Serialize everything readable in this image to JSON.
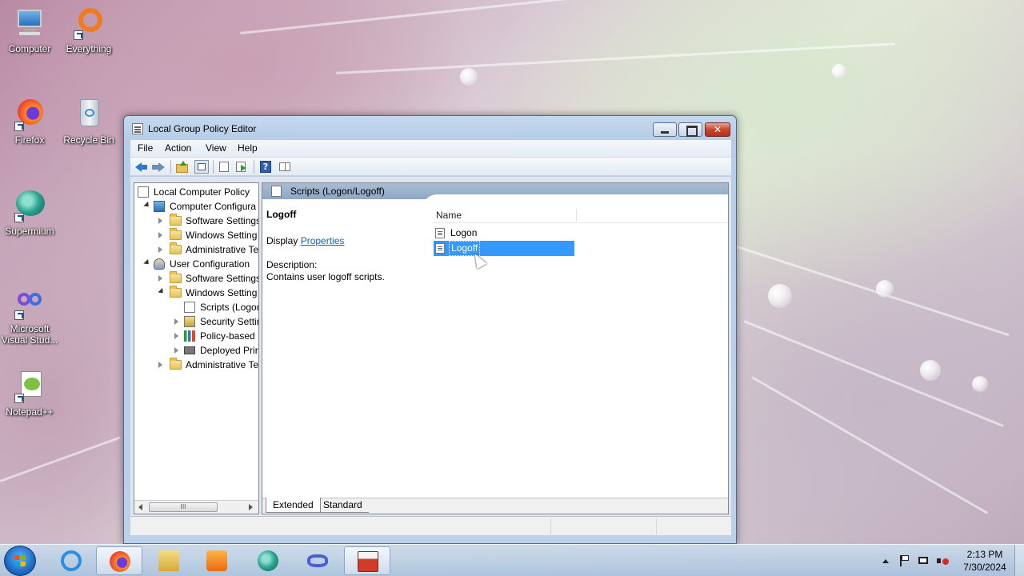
{
  "desktop": {
    "icons": [
      {
        "label": "Computer",
        "icon": "computer-icon"
      },
      {
        "label": "Everything",
        "icon": "everything-search-icon"
      },
      {
        "label": "Firefox",
        "icon": "firefox-icon"
      },
      {
        "label": "Recycle Bin",
        "icon": "recycle-bin-icon"
      },
      {
        "label": "Supermium",
        "icon": "supermium-icon"
      },
      {
        "label": "Microsoft Visual Stud...",
        "icon": "visual-studio-icon"
      },
      {
        "label": "Notepad++",
        "icon": "notepadplusplus-icon"
      }
    ]
  },
  "window": {
    "title": "Local Group Policy Editor",
    "menu": [
      "File",
      "Action",
      "View",
      "Help"
    ],
    "toolbar_icons": [
      "back-arrow-icon",
      "forward-arrow-icon",
      "up-folder-icon",
      "show-tree-icon",
      "properties-icon",
      "export-list-icon",
      "help-icon",
      "show-action-pane-icon"
    ],
    "tree": [
      {
        "label": "Local Computer Policy",
        "icon": "policy-icon",
        "expander": "none"
      },
      {
        "label": "Computer Configura",
        "icon": "computer-config-icon",
        "expander": "open"
      },
      {
        "label": "Software Settings",
        "icon": "folder-icon",
        "expander": "closed"
      },
      {
        "label": "Windows Setting",
        "icon": "folder-icon",
        "expander": "closed"
      },
      {
        "label": "Administrative Te",
        "icon": "folder-icon",
        "expander": "closed"
      },
      {
        "label": "User Configuration",
        "icon": "user-config-icon",
        "expander": "open"
      },
      {
        "label": "Software Settings",
        "icon": "folder-icon",
        "expander": "closed"
      },
      {
        "label": "Windows Setting",
        "icon": "folder-icon",
        "expander": "open"
      },
      {
        "label": "Scripts (Logon",
        "icon": "script-icon",
        "expander": "none"
      },
      {
        "label": "Security Settir",
        "icon": "security-icon",
        "expander": "closed"
      },
      {
        "label": "Policy-based",
        "icon": "chart-icon",
        "expander": "closed"
      },
      {
        "label": "Deployed Prir",
        "icon": "printer-icon",
        "expander": "closed"
      },
      {
        "label": "Administrative Te",
        "icon": "folder-icon",
        "expander": "closed"
      }
    ],
    "tree_scroll_grip": "III",
    "right_header": "Scripts (Logon/Logoff)",
    "details": {
      "title": "Logoff",
      "display_prefix": "Display",
      "display_link": "Properties",
      "description_label": "Description:",
      "description_text": "Contains user logoff scripts."
    },
    "list": {
      "column": "Name",
      "items": [
        {
          "label": "Logon",
          "selected": false
        },
        {
          "label": "Logoff",
          "selected": true
        }
      ]
    },
    "tabs": [
      "Extended",
      "Standard"
    ],
    "active_tab": "Extended"
  },
  "taskbar": {
    "pinned": [
      "internet-explorer-icon",
      "firefox-icon",
      "file-explorer-icon",
      "media-player-icon",
      "supermium-icon",
      "visual-studio-icon",
      "group-policy-editor-icon"
    ],
    "active": "group-policy-editor-icon",
    "clock_time": "2:13 PM",
    "clock_date": "7/30/2024",
    "tray_icons": [
      "show-hidden-icons-icon",
      "action-center-flag-icon",
      "network-icon",
      "volume-muted-icon"
    ]
  },
  "colors": {
    "selection": "#3399ff",
    "link": "#0b63c5",
    "window_frame": "#b7cde7",
    "close_button": "#c9452c"
  }
}
